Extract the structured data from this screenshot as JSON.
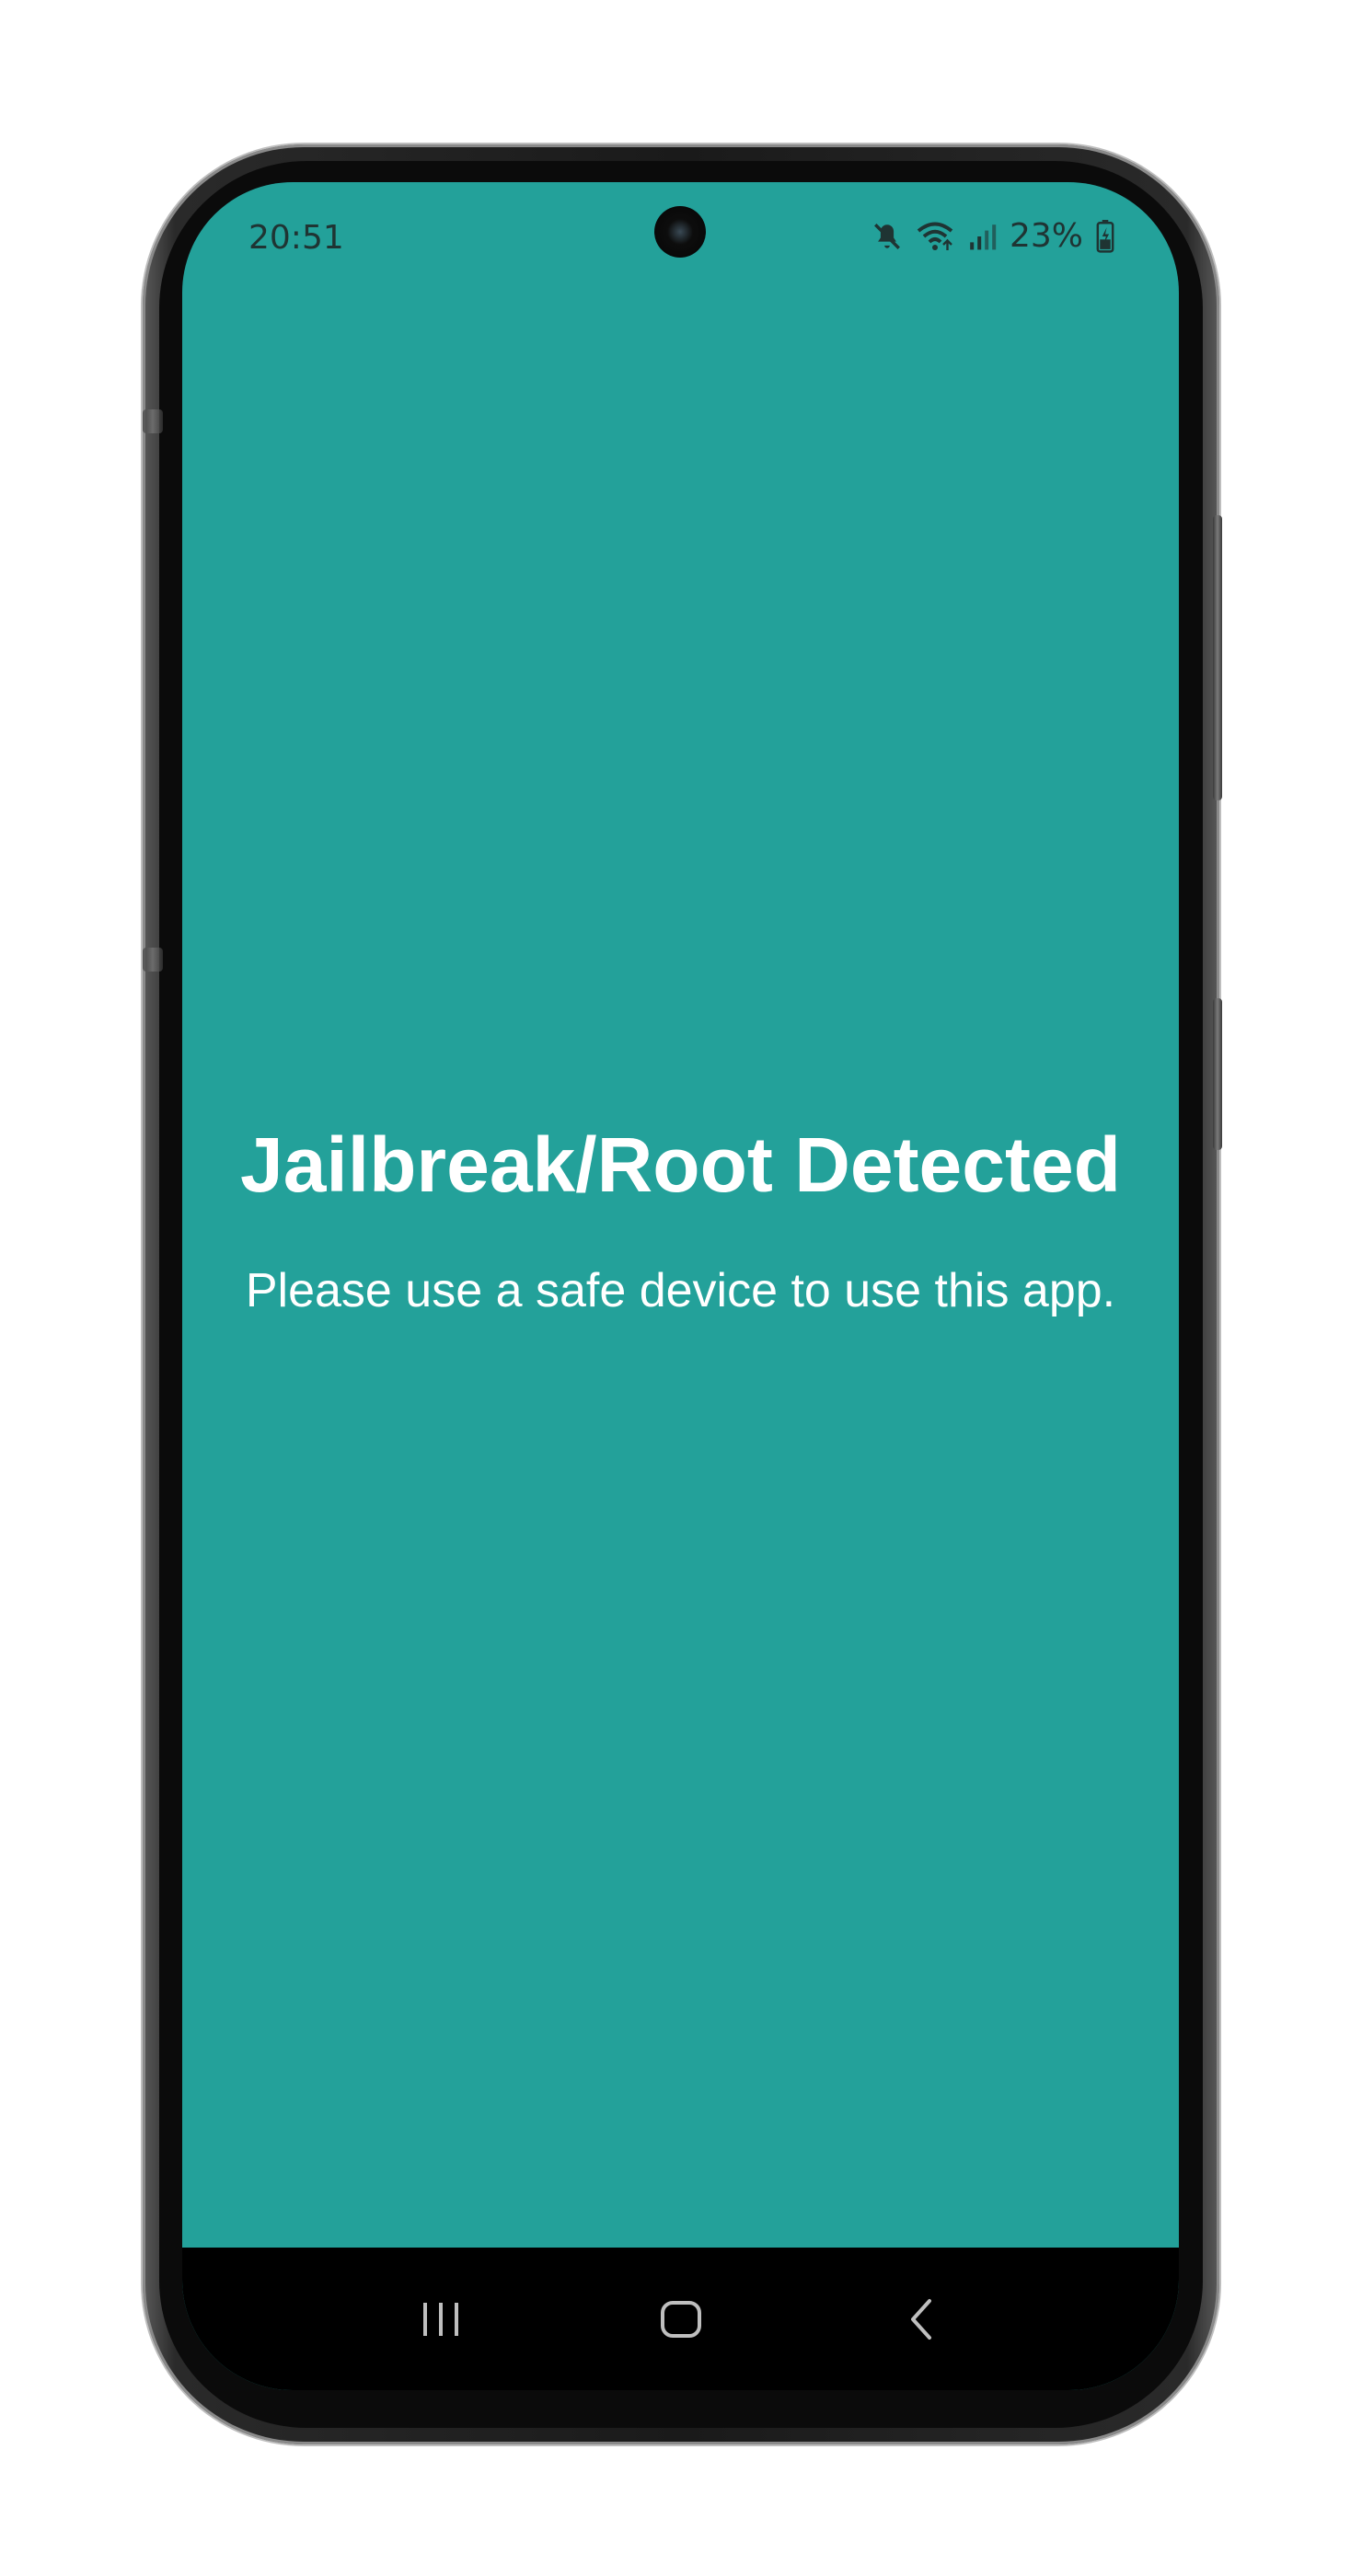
{
  "status_bar": {
    "time": "20:51",
    "battery_percent": "23%",
    "icons": [
      "mute-icon",
      "wifi-icon",
      "signal-icon",
      "battery-charging-icon"
    ]
  },
  "main": {
    "title": "Jailbreak/Root Detected",
    "message": "Please use a safe device to use this app."
  },
  "nav_bar": {
    "buttons": [
      "recent-apps-icon",
      "home-icon",
      "back-icon"
    ]
  },
  "colors": {
    "screen_background": "#23a19a",
    "text": "#ffffff",
    "nav_background": "#000000"
  }
}
